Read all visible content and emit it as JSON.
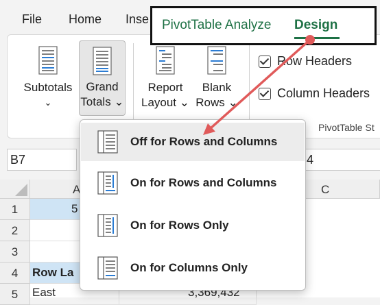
{
  "tabs": {
    "file": "File",
    "home": "Home",
    "insert_partial": "Inse",
    "pivot_analyze": "PivotTable Analyze",
    "design": "Design"
  },
  "ribbon": {
    "subtotals": {
      "line1": "Subtotals",
      "chevron": "⌄"
    },
    "grand_totals": {
      "line1": "Grand",
      "line2": "Totals ⌄"
    },
    "report_layout": {
      "line1": "Report",
      "line2": "Layout ⌄"
    },
    "blank_rows": {
      "line1": "Blank",
      "line2": "Rows ⌄"
    },
    "row_headers": "Row Headers",
    "column_headers": "Column Headers",
    "group_label_partial": "PivotTable St"
  },
  "formula_bar": {
    "name_box": "B7",
    "value_partial": "4"
  },
  "grid": {
    "col_a_partial": "A",
    "col_c": "C",
    "rows": [
      "1",
      "2",
      "3",
      "4",
      "5"
    ],
    "a1_partial": "5",
    "a4_partial": "Row La",
    "a5_partial": "East",
    "b5_partial": "3,369,432"
  },
  "menu": {
    "items": [
      {
        "label": "Off for Rows and Columns",
        "highlighted": true
      },
      {
        "label": "On for Rows and Columns",
        "highlighted": false
      },
      {
        "label": "On for Rows Only",
        "highlighted": false
      },
      {
        "label": "On for Columns Only",
        "highlighted": false
      }
    ]
  },
  "colors": {
    "accent_green": "#1e7145",
    "arrow_red": "#e05a5a",
    "icon_blue": "#2b7cd3"
  }
}
